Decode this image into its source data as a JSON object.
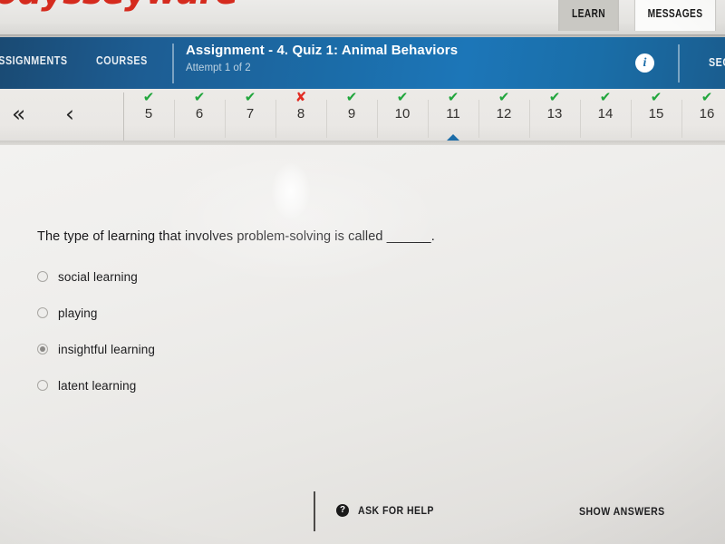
{
  "brand": {
    "logo_text": "odysseyware"
  },
  "top_tabs": [
    {
      "label": "LEARN",
      "active": true
    },
    {
      "label": "MESSAGES",
      "active": false
    }
  ],
  "header": {
    "nav": [
      {
        "label": "ASSIGNMENTS"
      },
      {
        "label": "COURSES"
      }
    ],
    "assignment_title": "Assignment  - 4. Quiz 1: Animal Behaviors",
    "attempt": "Attempt 1 of 2",
    "info_icon": "info-icon",
    "sections_label": "SECTIONS",
    "background_color": "#1b6ca8"
  },
  "question_strip": {
    "first_button_icon": "double-chevron-left-icon",
    "prev_button_icon": "chevron-left-icon",
    "current": "11",
    "items": [
      {
        "number": "5",
        "status": "correct"
      },
      {
        "number": "6",
        "status": "correct"
      },
      {
        "number": "7",
        "status": "correct"
      },
      {
        "number": "8",
        "status": "incorrect"
      },
      {
        "number": "9",
        "status": "correct"
      },
      {
        "number": "10",
        "status": "correct"
      },
      {
        "number": "11",
        "status": "correct"
      },
      {
        "number": "12",
        "status": "correct"
      },
      {
        "number": "13",
        "status": "correct"
      },
      {
        "number": "14",
        "status": "correct"
      },
      {
        "number": "15",
        "status": "correct"
      },
      {
        "number": "16",
        "status": "correct"
      }
    ],
    "correct_mark": "✔",
    "incorrect_mark": "✘",
    "correct_color": "#21a63c",
    "incorrect_color": "#e22b22"
  },
  "question": {
    "text": "The type of learning that involves problem-solving is called ______.",
    "options": [
      {
        "label": "social learning",
        "selected": false
      },
      {
        "label": "playing",
        "selected": false
      },
      {
        "label": "insightful learning",
        "selected": true
      },
      {
        "label": "latent learning",
        "selected": false
      }
    ]
  },
  "footer": {
    "ask_for_help": "ASK FOR HELP",
    "help_icon": "question-mark-circle-icon",
    "show_answers": "SHOW ANSWERS"
  }
}
